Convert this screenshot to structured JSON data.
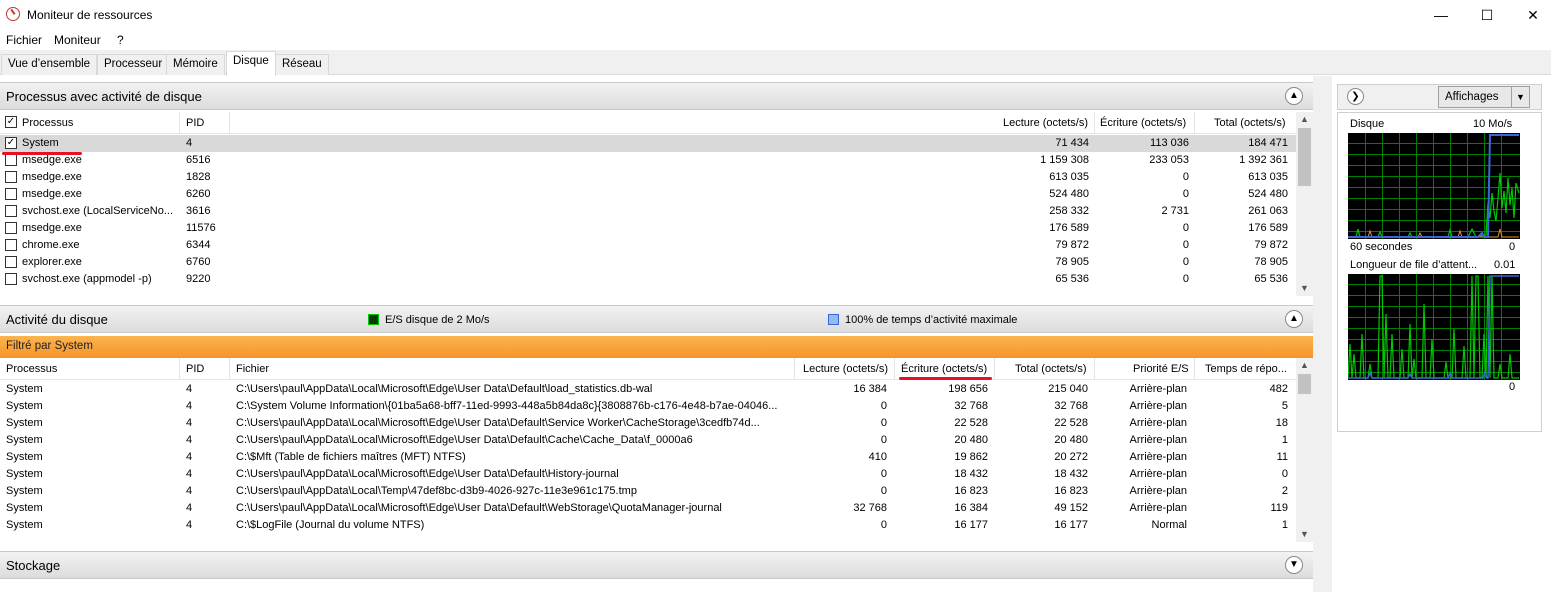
{
  "window": {
    "title": "Moniteur de ressources",
    "minimize": "—",
    "maximize": "☐",
    "close": "✕"
  },
  "menu": [
    "Fichier",
    "Moniteur",
    "?"
  ],
  "tabs": [
    "Vue d’ensemble",
    "Processeur",
    "Mémoire",
    "Disque",
    "Réseau"
  ],
  "active_tab": "Disque",
  "processes_section": {
    "title": "Processus avec activité de disque",
    "columns": [
      "Processus",
      "PID",
      "Lecture (octets/s)",
      "Écriture (octets/s)",
      "Total (octets/s)"
    ],
    "rows": [
      {
        "checked": true,
        "name": "System",
        "pid": "4",
        "read": "71 434",
        "write": "113 036",
        "total": "184 471"
      },
      {
        "checked": false,
        "name": "msedge.exe",
        "pid": "6516",
        "read": "1 159 308",
        "write": "233 053",
        "total": "1 392 361"
      },
      {
        "checked": false,
        "name": "msedge.exe",
        "pid": "1828",
        "read": "613 035",
        "write": "0",
        "total": "613 035"
      },
      {
        "checked": false,
        "name": "msedge.exe",
        "pid": "6260",
        "read": "524 480",
        "write": "0",
        "total": "524 480"
      },
      {
        "checked": false,
        "name": "svchost.exe (LocalServiceNo...",
        "pid": "3616",
        "read": "258 332",
        "write": "2 731",
        "total": "261 063"
      },
      {
        "checked": false,
        "name": "msedge.exe",
        "pid": "11576",
        "read": "176 589",
        "write": "0",
        "total": "176 589"
      },
      {
        "checked": false,
        "name": "chrome.exe",
        "pid": "6344",
        "read": "79 872",
        "write": "0",
        "total": "79 872"
      },
      {
        "checked": false,
        "name": "explorer.exe",
        "pid": "6760",
        "read": "78 905",
        "write": "0",
        "total": "78 905"
      },
      {
        "checked": false,
        "name": "svchost.exe (appmodel -p)",
        "pid": "9220",
        "read": "65 536",
        "write": "0",
        "total": "65 536"
      }
    ]
  },
  "disk_activity_section": {
    "title": "Activité du disque",
    "legend_io": "E/S disque de 2 Mo/s",
    "legend_active": "100% de temps d’activité maximale",
    "filter": "Filtré par System",
    "columns": [
      "Processus",
      "PID",
      "Fichier",
      "Lecture (octets/s)",
      "Écriture (octets/s)",
      "Total (octets/s)",
      "Priorité E/S",
      "Temps de répo..."
    ],
    "rows": [
      {
        "proc": "System",
        "pid": "4",
        "file": "C:\\Users\\paul\\AppData\\Local\\Microsoft\\Edge\\User Data\\Default\\load_statistics.db-wal",
        "read": "16 384",
        "write": "198 656",
        "total": "215 040",
        "prio": "Arrière-plan",
        "resp": "482"
      },
      {
        "proc": "System",
        "pid": "4",
        "file": "C:\\System Volume Information\\{01ba5a68-bff7-11ed-9993-448a5b84da8c}{3808876b-c176-4e48-b7ae-04046...",
        "read": "0",
        "write": "32 768",
        "total": "32 768",
        "prio": "Arrière-plan",
        "resp": "5"
      },
      {
        "proc": "System",
        "pid": "4",
        "file": "C:\\Users\\paul\\AppData\\Local\\Microsoft\\Edge\\User Data\\Default\\Service Worker\\CacheStorage\\3cedfb74d...",
        "read": "0",
        "write": "22 528",
        "total": "22 528",
        "prio": "Arrière-plan",
        "resp": "18"
      },
      {
        "proc": "System",
        "pid": "4",
        "file": "C:\\Users\\paul\\AppData\\Local\\Microsoft\\Edge\\User Data\\Default\\Cache\\Cache_Data\\f_0000a6",
        "read": "0",
        "write": "20 480",
        "total": "20 480",
        "prio": "Arrière-plan",
        "resp": "1"
      },
      {
        "proc": "System",
        "pid": "4",
        "file": "C:\\$Mft (Table de fichiers maîtres (MFT) NTFS)",
        "read": "410",
        "write": "19 862",
        "total": "20 272",
        "prio": "Arrière-plan",
        "resp": "11"
      },
      {
        "proc": "System",
        "pid": "4",
        "file": "C:\\Users\\paul\\AppData\\Local\\Microsoft\\Edge\\User Data\\Default\\History-journal",
        "read": "0",
        "write": "18 432",
        "total": "18 432",
        "prio": "Arrière-plan",
        "resp": "0"
      },
      {
        "proc": "System",
        "pid": "4",
        "file": "C:\\Users\\paul\\AppData\\Local\\Temp\\47def8bc-d3b9-4026-927c-11e3e961c175.tmp",
        "read": "0",
        "write": "16 823",
        "total": "16 823",
        "prio": "Arrière-plan",
        "resp": "2"
      },
      {
        "proc": "System",
        "pid": "4",
        "file": "C:\\Users\\paul\\AppData\\Local\\Microsoft\\Edge\\User Data\\Default\\WebStorage\\QuotaManager-journal",
        "read": "32 768",
        "write": "16 384",
        "total": "49 152",
        "prio": "Arrière-plan",
        "resp": "119"
      },
      {
        "proc": "System",
        "pid": "4",
        "file": "C:\\$LogFile (Journal du volume NTFS)",
        "read": "0",
        "write": "16 177",
        "total": "16 177",
        "prio": "Normal",
        "resp": "1"
      }
    ]
  },
  "storage_section": {
    "title": "Stockage"
  },
  "right_panel": {
    "views_button": "Affichages",
    "disk_graph": {
      "title": "Disque",
      "max_label": "10 Mo/s",
      "time_label": "60 secondes",
      "min_label": "0"
    },
    "queue_graph": {
      "title": "Longueur de file d’attent...",
      "max_label": "0.01",
      "min_label": "0"
    }
  },
  "colors": {
    "graph_bg": "#000000",
    "graph_grid": "#008000",
    "io_green": "#00c800",
    "active_blue": "#3a67d8",
    "filter_orange": "#f5942b",
    "highlight_red": "#e81123"
  }
}
